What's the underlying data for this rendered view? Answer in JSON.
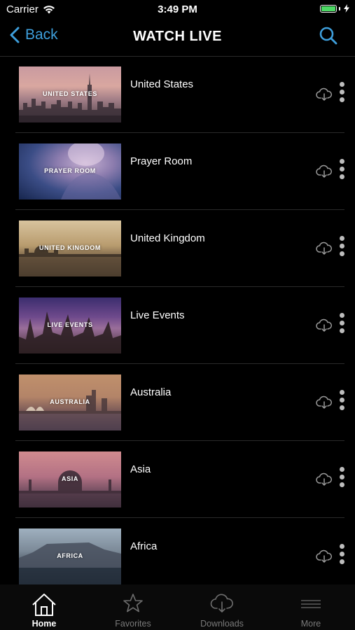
{
  "status_bar": {
    "carrier": "Carrier",
    "time": "3:49 PM"
  },
  "navbar": {
    "back_label": "Back",
    "title": "WATCH LIVE"
  },
  "channels": [
    {
      "label": "UNITED STATES",
      "title": "United States"
    },
    {
      "label": "PRAYER ROOM",
      "title": "Prayer Room"
    },
    {
      "label": "UNITED KINGDOM",
      "title": "United Kingdom"
    },
    {
      "label": "LIVE EVENTS",
      "title": "Live Events"
    },
    {
      "label": "AUSTRALIA",
      "title": "Australia"
    },
    {
      "label": "ASIA",
      "title": "Asia"
    },
    {
      "label": "AFRICA",
      "title": "Africa"
    }
  ],
  "tabs": [
    {
      "label": "Home",
      "icon": "home-icon",
      "active": true
    },
    {
      "label": "Favorites",
      "icon": "star-icon",
      "active": false
    },
    {
      "label": "Downloads",
      "icon": "cloud-download-icon",
      "active": false
    },
    {
      "label": "More",
      "icon": "menu-icon",
      "active": false
    }
  ],
  "colors": {
    "accent": "#3e9fdc",
    "battery": "#4cd964",
    "background": "#000000"
  }
}
